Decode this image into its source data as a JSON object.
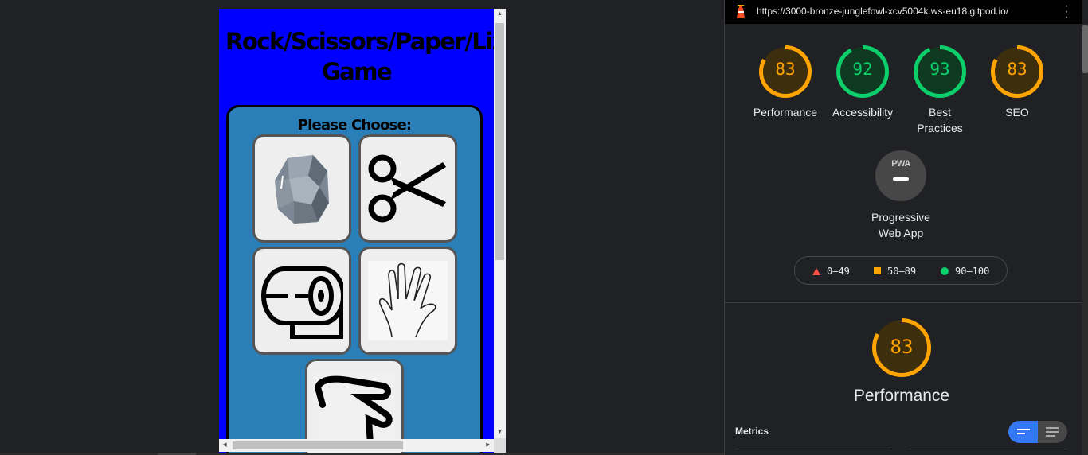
{
  "game": {
    "title_line1": "Rock/Scissors/Paper/Lizard/Spock",
    "title_line2": "Game",
    "choose_label": "Please Choose:",
    "choices": [
      "rock",
      "scissors",
      "paper",
      "spock",
      "lizard"
    ]
  },
  "lighthouse": {
    "url": "https://3000-bronze-junglefowl-xcv5004k.ws-eu18.gitpod.io/",
    "gauges": [
      {
        "score": "83",
        "label": "Performance",
        "color": "#ffa400",
        "track": "#3d2e0d",
        "fraction": 0.83
      },
      {
        "score": "92",
        "label": "Accessibility",
        "color": "#0cce6b",
        "track": "#0e3a21",
        "fraction": 0.92
      },
      {
        "score": "93",
        "label": "Best Practices",
        "color": "#0cce6b",
        "track": "#0e3a21",
        "fraction": 0.93
      },
      {
        "score": "83",
        "label": "SEO",
        "color": "#ffa400",
        "track": "#3d2e0d",
        "fraction": 0.83
      }
    ],
    "pwa": {
      "badge": "PWA",
      "label": "Progressive Web App"
    },
    "legend": {
      "fail": "0–49",
      "average": "50–89",
      "pass": "90–100"
    },
    "performance": {
      "score": "83",
      "title": "Performance",
      "fraction": 0.83,
      "color": "#ffa400"
    },
    "metrics_label": "Metrics"
  }
}
